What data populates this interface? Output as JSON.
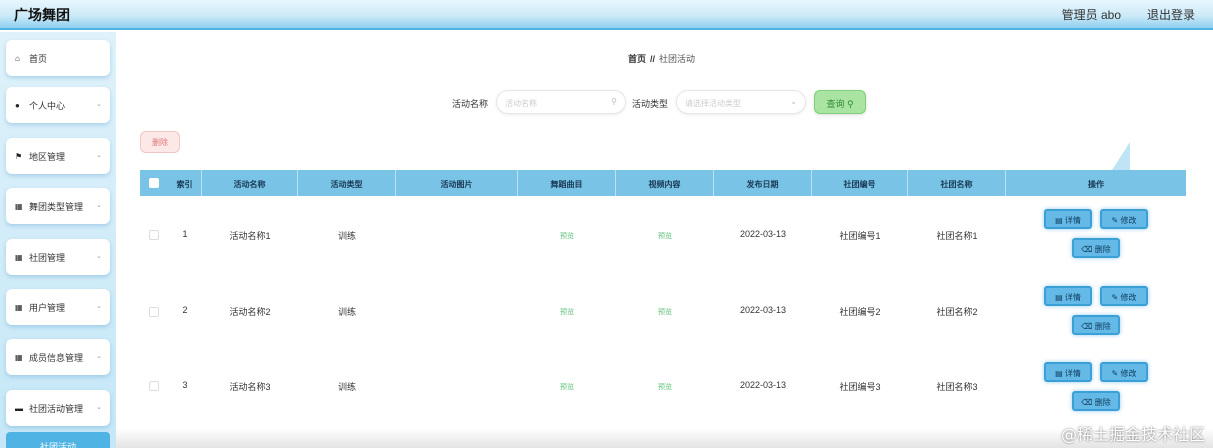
{
  "header": {
    "app_title": "广场舞团",
    "admin_label": "管理员 abo",
    "logout_label": "退出登录"
  },
  "sidebar": {
    "items": [
      {
        "label": "首页",
        "icon": "home-icon"
      },
      {
        "label": "个人中心",
        "icon": "person-icon"
      },
      {
        "label": "地区管理",
        "icon": "flag-icon"
      },
      {
        "label": "舞团类型管理",
        "icon": "grid-icon"
      },
      {
        "label": "社团管理",
        "icon": "grid-icon"
      },
      {
        "label": "用户管理",
        "icon": "grid-icon"
      },
      {
        "label": "成员信息管理",
        "icon": "grid-icon"
      },
      {
        "label": "社团活动管理",
        "icon": "monitor-icon"
      }
    ],
    "active_item": "社团活动"
  },
  "breadcrumb": {
    "home": "首页",
    "separator": "//",
    "current": "社团活动"
  },
  "search": {
    "name_label": "活动名称",
    "name_placeholder": "活动名称",
    "type_label": "活动类型",
    "type_placeholder": "请选择活动类型",
    "button_label": "查询"
  },
  "toolbar": {
    "delete_label": "删除"
  },
  "table": {
    "columns": [
      "索引",
      "活动名称",
      "活动类型",
      "活动图片",
      "舞蹈曲目",
      "视频内容",
      "发布日期",
      "社团编号",
      "社团名称",
      "操作"
    ],
    "rows": [
      {
        "index": "1",
        "name": "活动名称1",
        "type": "训练",
        "music": "预览",
        "video": "预览",
        "date": "2022-03-13",
        "club_no": "社团编号1",
        "club_name": "社团名称1"
      },
      {
        "index": "2",
        "name": "活动名称2",
        "type": "训练",
        "music": "预览",
        "video": "预览",
        "date": "2022-03-13",
        "club_no": "社团编号2",
        "club_name": "社团名称2"
      },
      {
        "index": "3",
        "name": "活动名称3",
        "type": "训练",
        "music": "预览",
        "video": "预览",
        "date": "2022-03-13",
        "club_no": "社团编号3",
        "club_name": "社团名称3"
      }
    ],
    "actions": {
      "detail": "详情",
      "edit": "修改",
      "delete": "删除"
    }
  },
  "watermark": "@稀土掘金技术社区",
  "colors": {
    "accent": "#4fb3e4",
    "table_header": "#78c3e6",
    "search_button": "#a9e4a3",
    "link": "#5cbf7a"
  }
}
